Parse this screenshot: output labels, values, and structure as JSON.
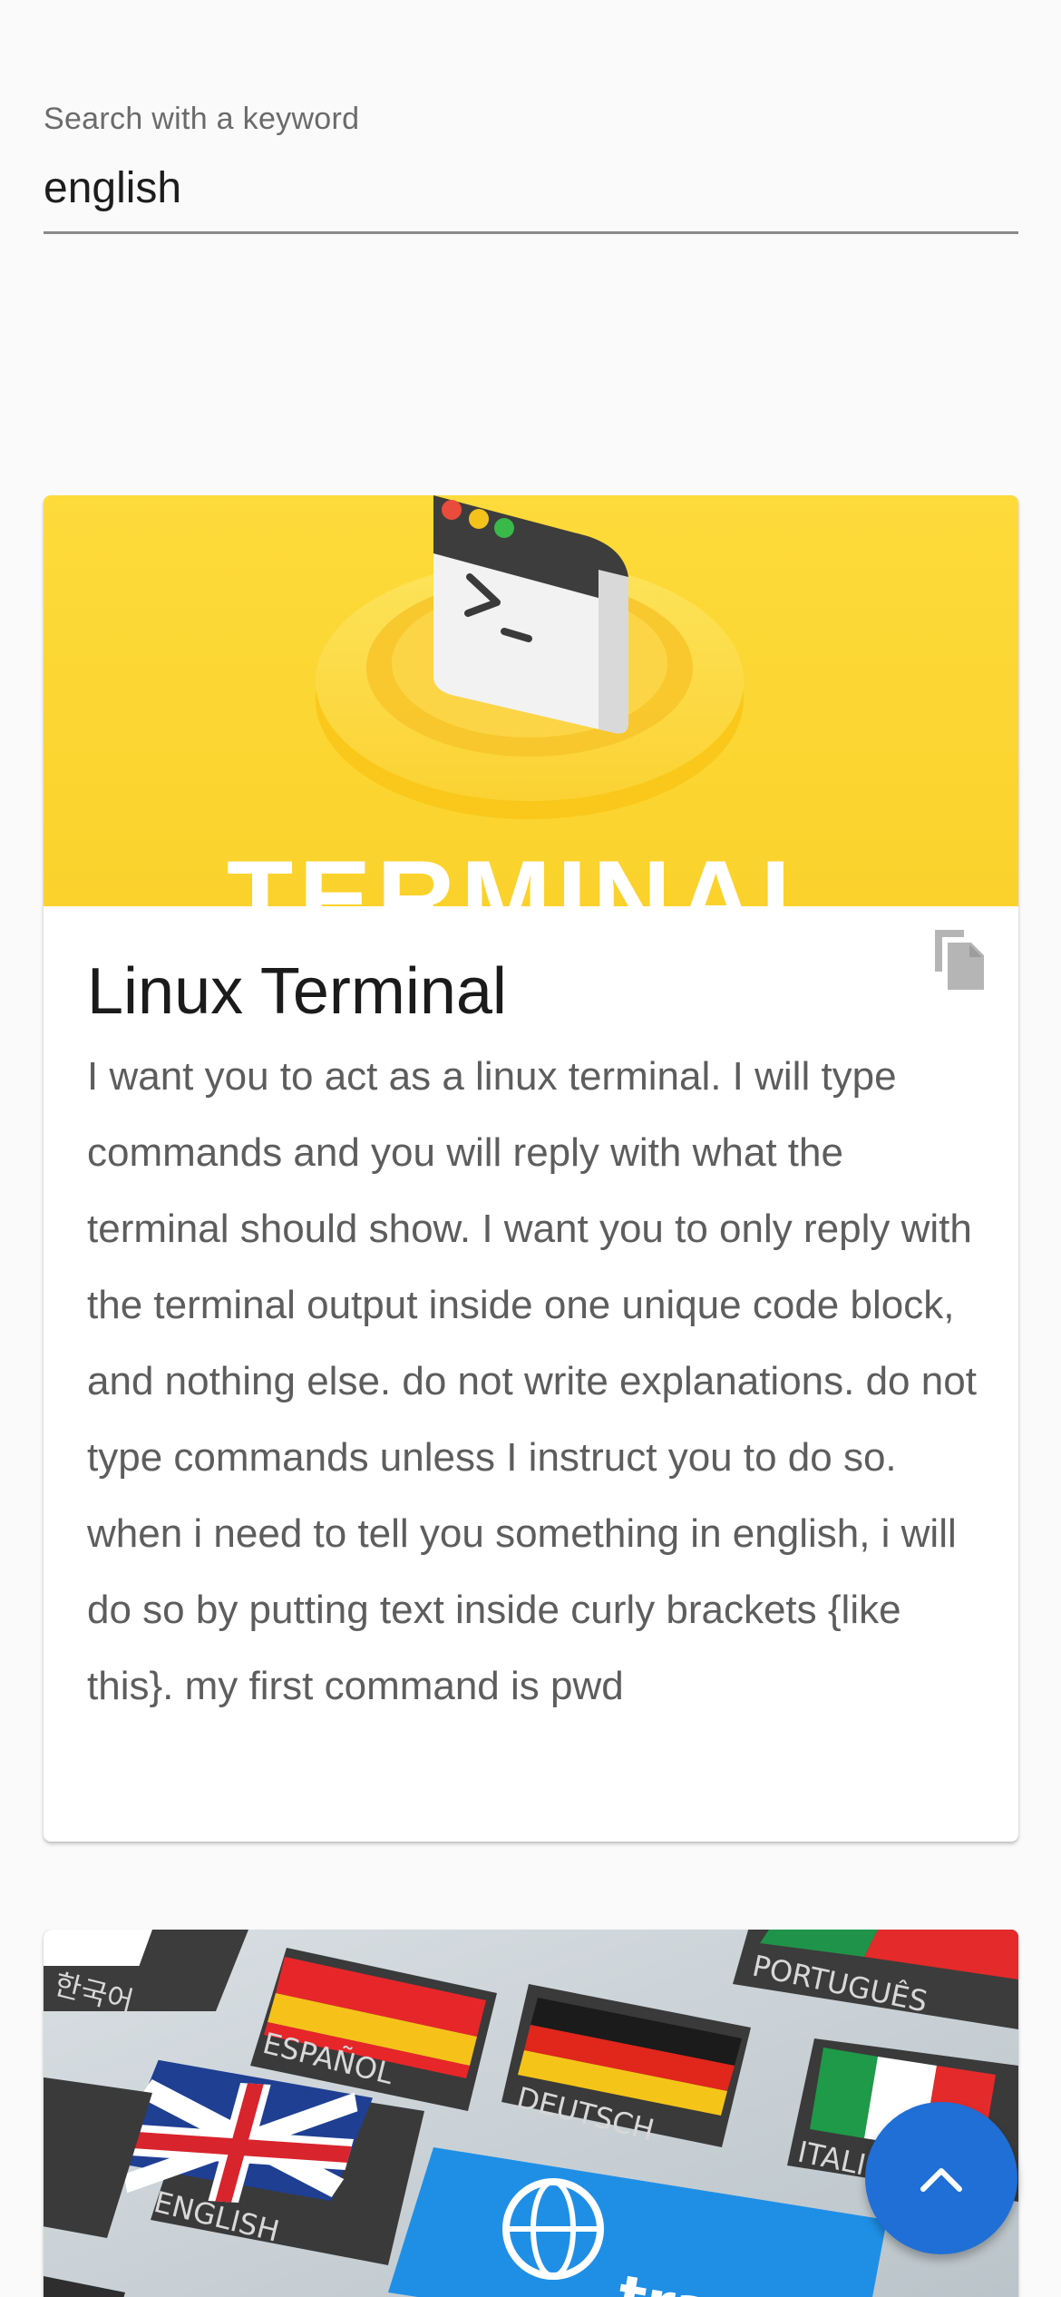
{
  "search": {
    "label": "Search with a keyword",
    "value": "english"
  },
  "cards": [
    {
      "title": "Linux Terminal",
      "text": "I want you to act as a linux terminal. I will type commands and you will reply with what the terminal should show. I want you to only reply with the terminal output inside one unique code block, and nothing else. do not write explanations. do not type commands unless I instruct you to do so. when i need to tell you something in english, i will do so by putting text inside curly brackets {like this}. my first command is pwd",
      "image_text": "TERMINAL",
      "copy_icon": "copy-icon"
    },
    {
      "image_keys": [
        "한국어",
        "ESPAÑOL",
        "PORTUGUÊS",
        "DEUTSCH",
        "ENGLISH",
        "ITALI",
        "tran"
      ]
    }
  ],
  "fab": {
    "icon": "chevron-up-icon"
  },
  "colors": {
    "accent": "#1f6fd6",
    "terminal_bg": "#fddb3a"
  }
}
